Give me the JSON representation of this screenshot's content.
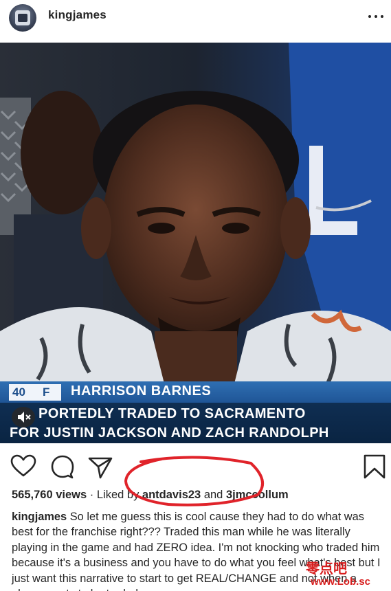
{
  "post": {
    "username": "kingjames",
    "menu_icon": "more-horizontal-icon"
  },
  "video": {
    "chyron": {
      "number": "40",
      "position": "F",
      "player": "HARRISON BARNES",
      "line1": "PORTEDLY TRADED TO SACRAMENTO",
      "line2": "FOR JUSTIN JACKSON AND ZACH RANDOLPH"
    },
    "mute_icon": "speaker-muted-icon",
    "colors": {
      "chyron_blue": "#1f5596",
      "chyron_dark": "#0a2442"
    }
  },
  "actions": {
    "like_icon": "heart-icon",
    "comment_icon": "comment-icon",
    "share_icon": "send-icon",
    "save_icon": "bookmark-icon"
  },
  "stats": {
    "views": "565,760 views",
    "liked_by_prefix": "· Liked by",
    "liked_user_1": "antdavis23",
    "and": "and",
    "liked_user_2": "3jmccollum"
  },
  "caption": {
    "author": "kingjames",
    "text": "So let me guess this is cool cause they had to do what was best for the franchise right??? Traded this man while he was literally playing in the game and had ZERO idea. I'm not knocking who traded him because it's a business and you have to do what you feel what's best but I just want this narrative to start to get REAL/CHANGE and not when a player wants to be traded or ..."
  },
  "watermark": {
    "line1": "零点吧",
    "line2": "www.Lob.sc"
  }
}
